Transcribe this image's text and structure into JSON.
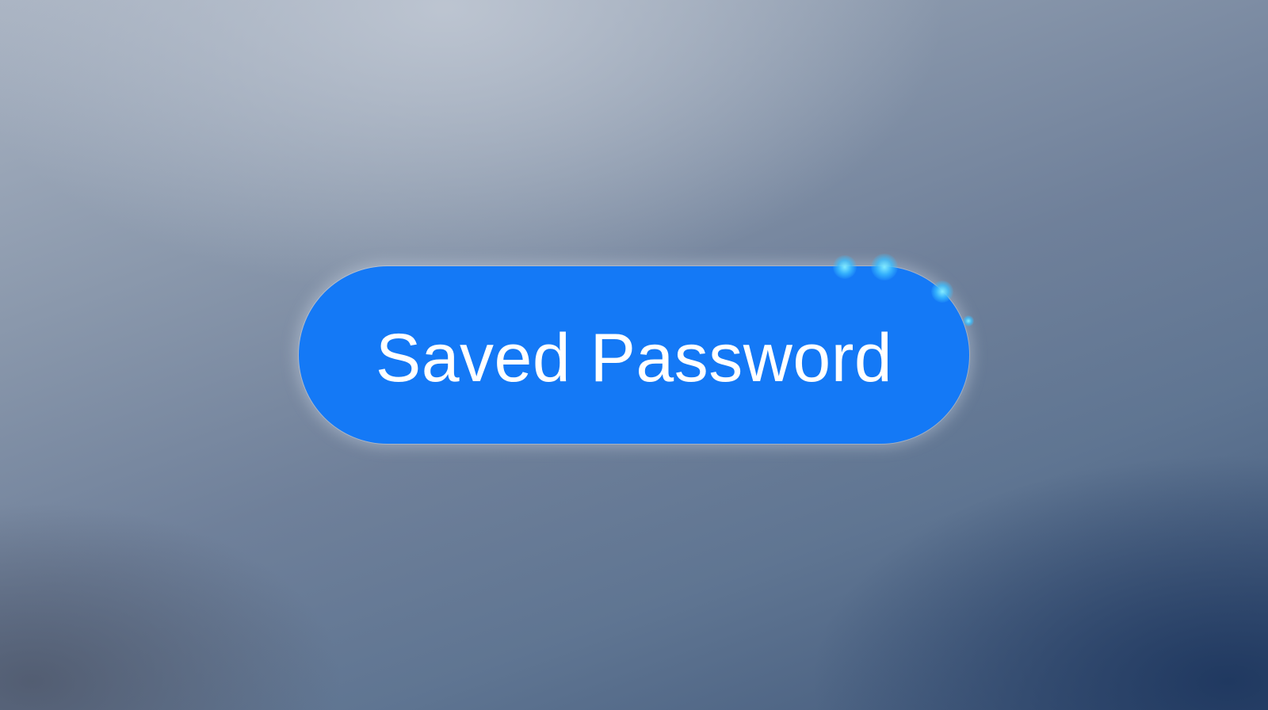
{
  "button": {
    "label": "Saved Password",
    "color": "#1479f6",
    "text_color": "#ffffff",
    "icon": "sparkle-icon"
  },
  "background": {
    "style": "blurred blue-gray gradient"
  }
}
